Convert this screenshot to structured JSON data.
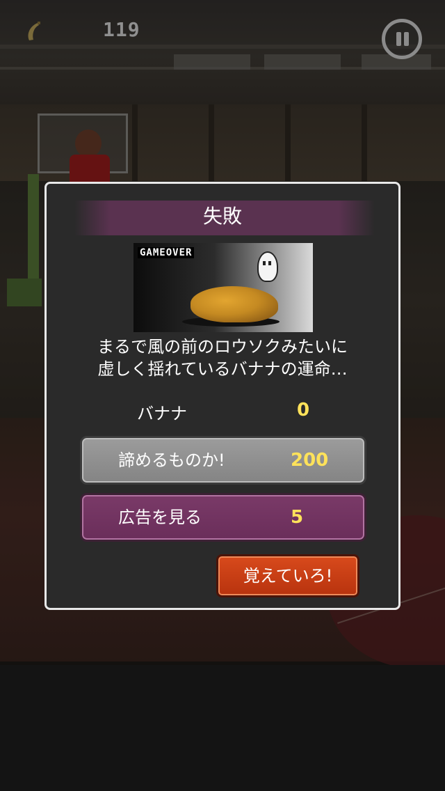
{
  "hud": {
    "score": "119",
    "banana_icon": "banana-icon",
    "pause_icon": "pause-icon"
  },
  "dialog": {
    "title": "失敗",
    "image_caption": "GAMEOVER",
    "message_line1": "まるで風の前のロウソクみたいに",
    "message_line2": "虚しく揺れているバナナの運命…",
    "banana_label": "バナナ",
    "banana_count": "0",
    "give_up_button": {
      "label": "諦めるものか!",
      "cost": "200"
    },
    "watch_ad_button": {
      "label": "広告を見る",
      "reward": "5"
    },
    "remember_button": {
      "label": "覚えていろ!"
    }
  },
  "colors": {
    "dialog_bg": "#2a2a2a",
    "title_bar": "#5a3250",
    "value_yellow": "#ffe25a",
    "ad_button": "#6a2e5a",
    "remember_button": "#c83a12",
    "give_up_button": "#8e8e8e"
  }
}
